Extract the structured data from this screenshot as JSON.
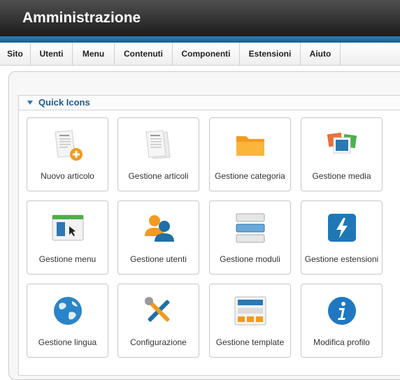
{
  "header": {
    "title": "Amministrazione"
  },
  "menu": [
    "Sito",
    "Utenti",
    "Menu",
    "Contenuti",
    "Componenti",
    "Estensioni",
    "Aiuto"
  ],
  "quick_icons": {
    "title": "Quick Icons",
    "tiles": [
      {
        "label": "Nuovo articolo",
        "icon": "new-article-icon"
      },
      {
        "label": "Gestione articoli",
        "icon": "articles-icon"
      },
      {
        "label": "Gestione categoria",
        "icon": "folder-icon"
      },
      {
        "label": "Gestione media",
        "icon": "media-icon"
      },
      {
        "label": "Gestione menu",
        "icon": "menu-window-icon"
      },
      {
        "label": "Gestione utenti",
        "icon": "users-icon"
      },
      {
        "label": "Gestione moduli",
        "icon": "modules-icon"
      },
      {
        "label": "Gestione estensioni",
        "icon": "extensions-icon"
      },
      {
        "label": "Gestione lingua",
        "icon": "globe-icon"
      },
      {
        "label": "Configurazione",
        "icon": "tools-icon"
      },
      {
        "label": "Gestione template",
        "icon": "template-icon"
      },
      {
        "label": "Modifica profilo",
        "icon": "info-icon"
      }
    ]
  },
  "colors": {
    "accent": "#2a7db5",
    "header_dark": "#1c1c1c",
    "title_blue": "#1f5a8a"
  }
}
